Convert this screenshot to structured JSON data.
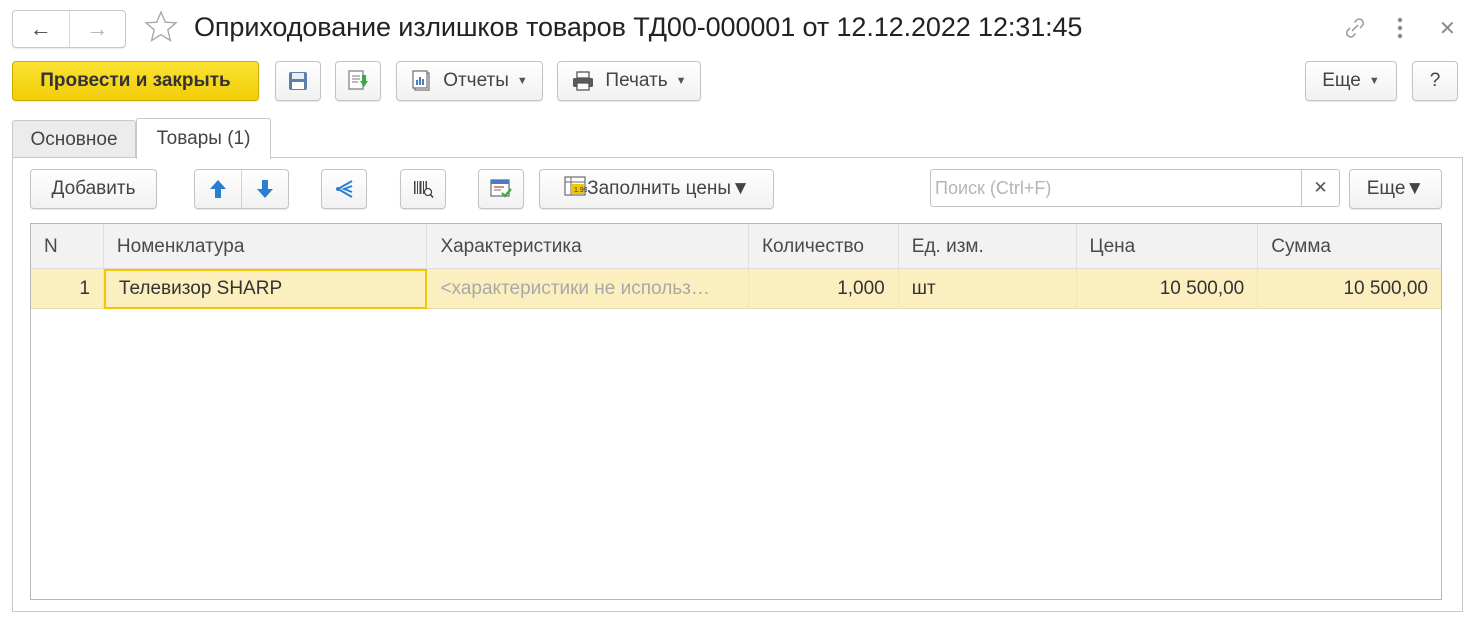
{
  "header": {
    "title": "Оприходование излишков товаров ТД00-000001 от 12.12.2022 12:31:45"
  },
  "commandbar": {
    "post_close_label": "Провести и закрыть",
    "reports_label": "Отчеты",
    "print_label": "Печать",
    "more_label": "Еще",
    "help_label": "?"
  },
  "tabs": [
    {
      "label": "Основное",
      "active": false
    },
    {
      "label": "Товары (1)",
      "active": true
    }
  ],
  "goods_toolbar": {
    "add_label": "Добавить",
    "fill_prices_label": "Заполнить цены",
    "search_placeholder": "Поиск (Ctrl+F)",
    "more_label": "Еще"
  },
  "table": {
    "columns": [
      "N",
      "Номенклатура",
      "Характеристика",
      "Количество",
      "Ед. изм.",
      "Цена",
      "Сумма"
    ],
    "rows": [
      {
        "n": "1",
        "nomenclature": "Телевизор SHARP",
        "characteristic": "<характеристики не использ…",
        "quantity": "1,000",
        "unit": "шт",
        "price": "10 500,00",
        "sum": "10 500,00"
      }
    ]
  },
  "colors": {
    "primary_button": "#f5d41a",
    "selected_row": "#fcefbf",
    "focus_border": "#f2c600",
    "arrow_blue": "#2a7fd4"
  },
  "icons": [
    "back-arrow-icon",
    "forward-arrow-icon",
    "star-icon",
    "link-icon",
    "more-vertical-icon",
    "close-icon",
    "save-icon",
    "post-icon",
    "reports-icon",
    "printer-icon",
    "move-up-icon",
    "move-down-icon",
    "distribute-icon",
    "barcode-icon",
    "select-icon",
    "fill-prices-icon"
  ]
}
